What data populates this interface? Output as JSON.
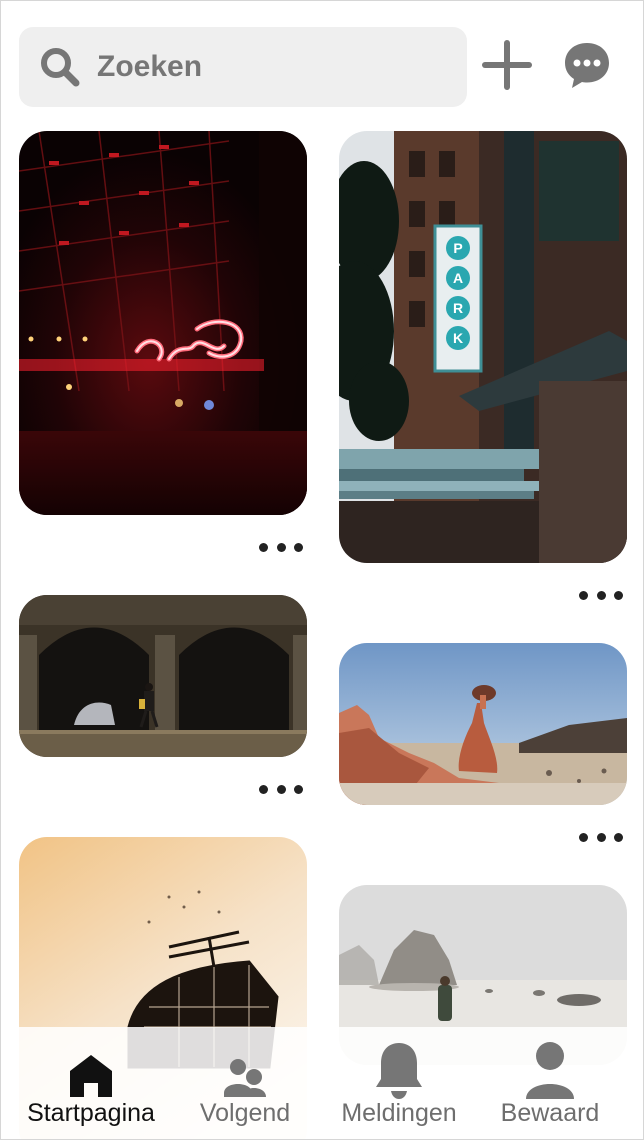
{
  "search": {
    "placeholder": "Zoeken",
    "icon": "search-icon"
  },
  "header_actions": [
    {
      "name": "add-button",
      "icon": "plus-icon"
    },
    {
      "name": "messages-button",
      "icon": "chat-bubble-icon"
    }
  ],
  "pins": [
    {
      "name": "pin-neon-sign",
      "column": "left",
      "description_icon": "more-options-icon"
    },
    {
      "name": "pin-park-building",
      "column": "right",
      "description_icon": "more-options-icon"
    },
    {
      "name": "pin-arcade-walker",
      "column": "left",
      "description_icon": "more-options-icon"
    },
    {
      "name": "pin-desert-rocks",
      "column": "right",
      "description_icon": "more-options-icon"
    },
    {
      "name": "pin-sunset-structure",
      "column": "left"
    },
    {
      "name": "pin-foggy-beach",
      "column": "right"
    }
  ],
  "nav": {
    "items": [
      {
        "label": "Startpagina",
        "icon": "home-icon",
        "active": true
      },
      {
        "label": "Volgend",
        "icon": "people-icon",
        "active": false
      },
      {
        "label": "Meldingen",
        "icon": "bell-icon",
        "active": false
      },
      {
        "label": "Bewaard",
        "icon": "profile-icon",
        "active": false
      }
    ]
  },
  "colors": {
    "active": "#111111",
    "inactive": "#6e6e6e",
    "search_bg": "#efefef",
    "icon_gray": "#767676"
  }
}
